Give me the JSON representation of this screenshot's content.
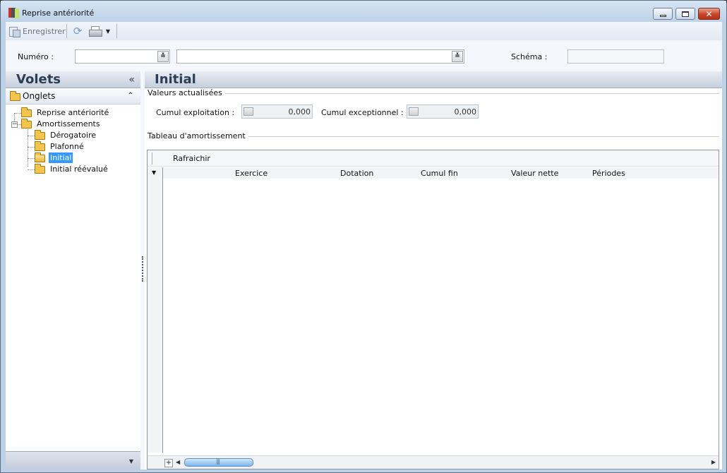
{
  "window": {
    "title": "Reprise antériorité",
    "minimize_icon": "minimize-icon",
    "maximize_icon": "restore-icon",
    "close_icon": "close-icon",
    "close_glyph": "✕"
  },
  "toolbar": {
    "save_label": "Enregistrer",
    "save_icon": "save-icon",
    "refresh_icon": "refresh-icon",
    "print_icon": "printer-icon",
    "dropdown_glyph": "▼"
  },
  "header": {
    "numero_label": "Numéro :",
    "numero_value": "",
    "numero_desc_value": "",
    "schema_label": "Schéma :",
    "schema_value": "",
    "dropdown_glyph": "≚"
  },
  "left_panel": {
    "title": "Volets",
    "collapse_glyph": "«",
    "group_title": "Onglets",
    "group_toggle_glyph": "⌃",
    "tree": [
      {
        "label": "Reprise antériorité",
        "level": 0
      },
      {
        "label": "Amortissements",
        "level": 0,
        "expander": "−"
      },
      {
        "label": "Dérogatoire",
        "level": 1
      },
      {
        "label": "Plafonné",
        "level": 1
      },
      {
        "label": "Initial",
        "level": 1,
        "selected": true
      },
      {
        "label": "Initial réévalué",
        "level": 1
      }
    ],
    "footer_glyph": "▼"
  },
  "main": {
    "title": "Initial",
    "valeurs_legend": "Valeurs actualisées",
    "cumul_exploitation_label": "Cumul exploitation :",
    "cumul_exploitation_value": "0,000",
    "cumul_exceptionnel_label": "Cumul exceptionnel :",
    "cumul_exceptionnel_value": "0,000",
    "tableau_legend": "Tableau d'amortissement",
    "grid": {
      "refresh_label": "Rafraichir",
      "row_caret": "▼",
      "columns": [
        "Exercice",
        "Dotation",
        "Cumul fin",
        "Valeur nette",
        "Périodes"
      ],
      "rows": [],
      "add_glyph": "+",
      "scroll_left": "◀",
      "scroll_right": "▶"
    }
  },
  "colors": {
    "selection": "#3399ff",
    "header_text": "#2c3e55",
    "titlebar": "#bdd1e8"
  }
}
